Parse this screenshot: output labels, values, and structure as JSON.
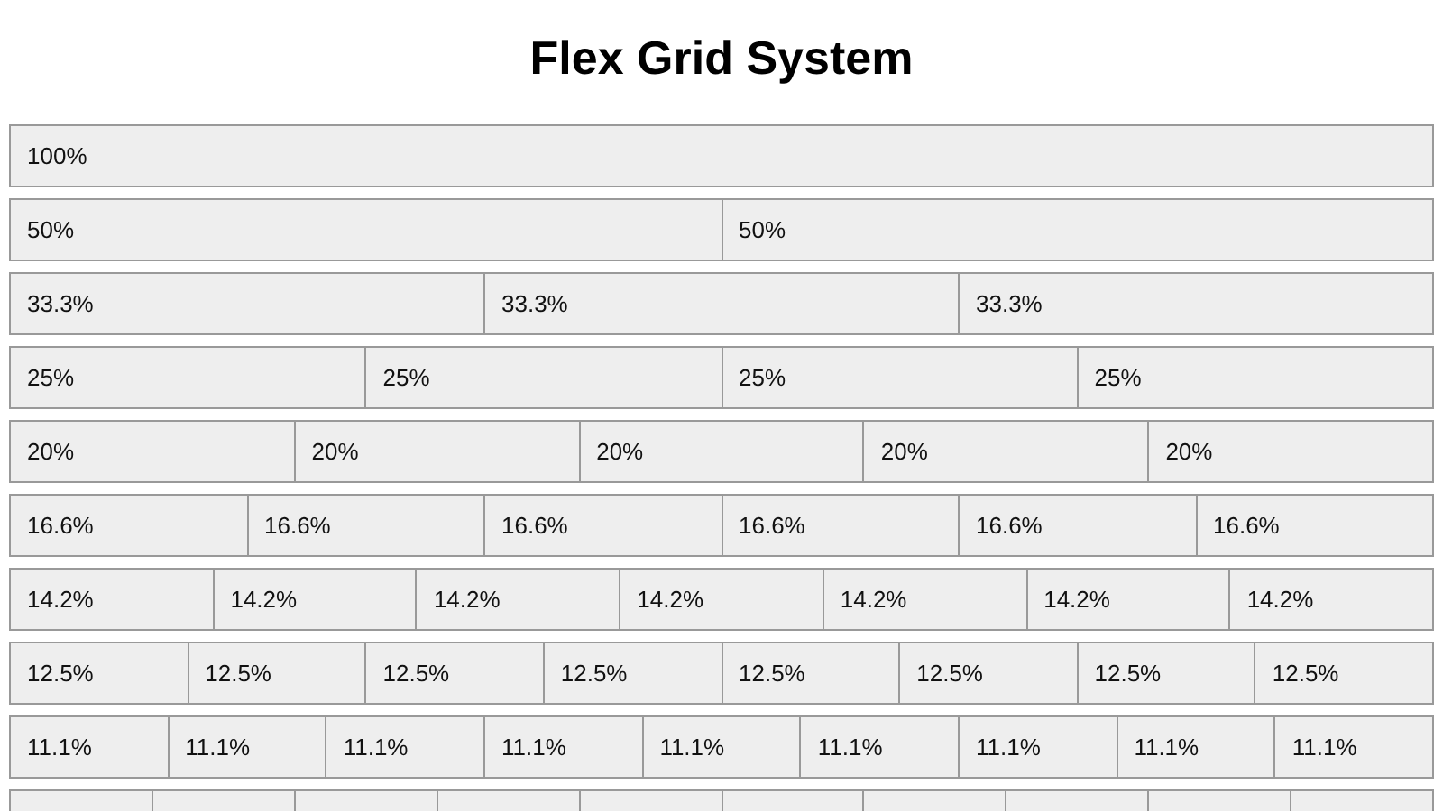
{
  "title": "Flex Grid System",
  "rows": [
    {
      "cells": [
        {
          "label": "100%"
        }
      ]
    },
    {
      "cells": [
        {
          "label": "50%"
        },
        {
          "label": "50%"
        }
      ]
    },
    {
      "cells": [
        {
          "label": "33.3%"
        },
        {
          "label": "33.3%"
        },
        {
          "label": "33.3%"
        }
      ]
    },
    {
      "cells": [
        {
          "label": "25%"
        },
        {
          "label": "25%"
        },
        {
          "label": "25%"
        },
        {
          "label": "25%"
        }
      ]
    },
    {
      "cells": [
        {
          "label": "20%"
        },
        {
          "label": "20%"
        },
        {
          "label": "20%"
        },
        {
          "label": "20%"
        },
        {
          "label": "20%"
        }
      ]
    },
    {
      "cells": [
        {
          "label": "16.6%"
        },
        {
          "label": "16.6%"
        },
        {
          "label": "16.6%"
        },
        {
          "label": "16.6%"
        },
        {
          "label": "16.6%"
        },
        {
          "label": "16.6%"
        }
      ]
    },
    {
      "cells": [
        {
          "label": "14.2%"
        },
        {
          "label": "14.2%"
        },
        {
          "label": "14.2%"
        },
        {
          "label": "14.2%"
        },
        {
          "label": "14.2%"
        },
        {
          "label": "14.2%"
        },
        {
          "label": "14.2%"
        }
      ]
    },
    {
      "cells": [
        {
          "label": "12.5%"
        },
        {
          "label": "12.5%"
        },
        {
          "label": "12.5%"
        },
        {
          "label": "12.5%"
        },
        {
          "label": "12.5%"
        },
        {
          "label": "12.5%"
        },
        {
          "label": "12.5%"
        },
        {
          "label": "12.5%"
        }
      ]
    },
    {
      "cells": [
        {
          "label": "11.1%"
        },
        {
          "label": "11.1%"
        },
        {
          "label": "11.1%"
        },
        {
          "label": "11.1%"
        },
        {
          "label": "11.1%"
        },
        {
          "label": "11.1%"
        },
        {
          "label": "11.1%"
        },
        {
          "label": "11.1%"
        },
        {
          "label": "11.1%"
        }
      ]
    },
    {
      "cells": [
        {},
        {},
        {},
        {},
        {},
        {},
        {},
        {},
        {},
        {}
      ]
    }
  ]
}
